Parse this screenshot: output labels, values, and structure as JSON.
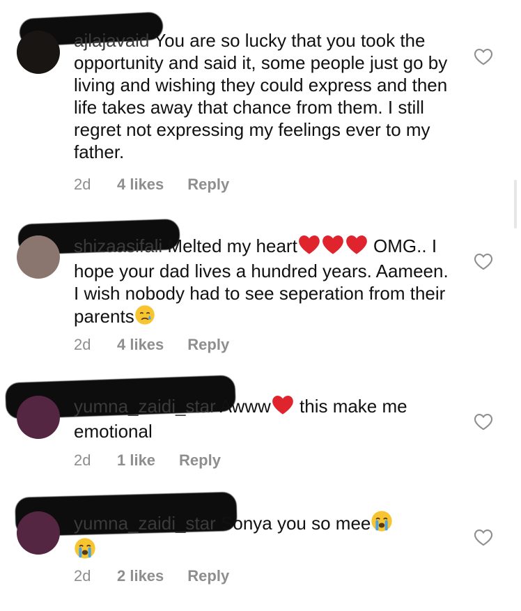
{
  "comments": [
    {
      "username": "ajlajavaid",
      "text": "You are so lucky that you took the opportunity and said it, some people just go by living and wishing they could express and then life takes away that chance from them. I still regret not expressing my feelings ever to my father.",
      "time": "2d",
      "likes": "4 likes",
      "reply": "Reply",
      "avatar_color": "#2a211d"
    },
    {
      "username": "shizaasifali",
      "text_before": "Melted my heart",
      "text_after": "OMG.. I hope your dad lives a hundred years. Aameen. I wish nobody had to see seperation from their parents",
      "time": "2d",
      "likes": "4 likes",
      "reply": "Reply",
      "avatar_color": "#b9928a"
    },
    {
      "username": "yumna_zaidi_star",
      "text_before": "Awww",
      "text_after": " this make me emotional",
      "time": "2d",
      "likes": "1 like",
      "reply": "Reply",
      "avatar_color": "#8a3c6a"
    },
    {
      "username": "yumna_zaidi_star",
      "text": "Sonya you so mee",
      "time": "2d",
      "likes": "2 likes",
      "reply": "Reply",
      "avatar_color": "#8a3c6a"
    }
  ],
  "colors": {
    "meta_gray": "#8e8e8e",
    "text": "#111111",
    "heart_red": "#e0242e",
    "emoji_yellow": "#f7c531"
  }
}
